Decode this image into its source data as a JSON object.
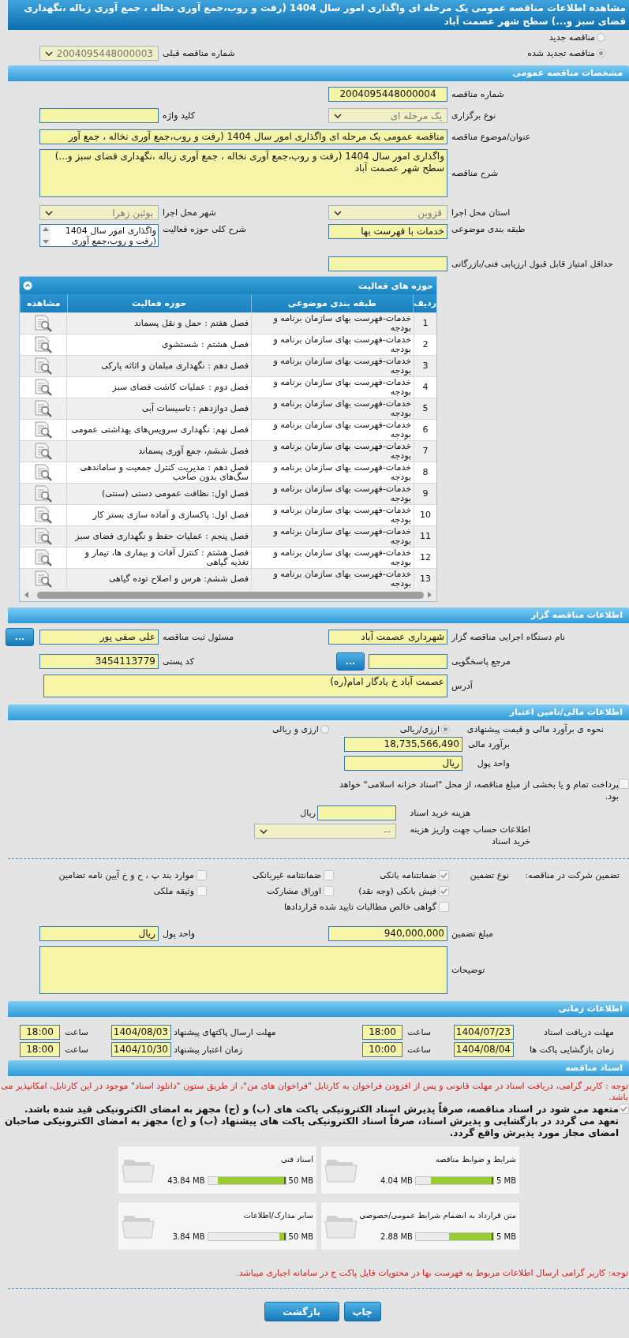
{
  "title": "مشاهده اطلاعات مناقصه عمومی یک مرحله ای واگذاری امور سال 1404 (رفت و روب،جمع آوری نخاله ، جمع آوری زباله ،نگهداری فضای سبز و...) سطح شهر عصمت آباد",
  "tender_kind": [
    {
      "label": "مناقصه جدید",
      "selected": false
    },
    {
      "label": "مناقصه تجدید شده",
      "selected": true
    }
  ],
  "previous_tender": {
    "label": "شماره مناقصه قبلی",
    "value": "2004095448000003"
  },
  "general": {
    "heading": "مشخصات مناقصه عمومی",
    "tender_number": {
      "label": "شماره مناقصه",
      "value": "2004095448000004"
    },
    "holding_type": {
      "label": "نوع برگزاری",
      "value": "یک مرحله ای"
    },
    "keyword": {
      "label": "کلید واژه"
    },
    "subject": {
      "label": "عنوان/موضوع مناقصه",
      "value": "مناقصه عمومی یک مرحله ای واگذاری  امور سال  1404 (رفت و روب،جمع آوری نخاله ، جمع آور"
    },
    "description": {
      "label": "شرح مناقصه",
      "value": "واگذاری  امور سال  1404 (رفت و روب،جمع آوری نخاله ، جمع آوری زباله ،نگهداری فضای سبز و...) سطح  شهر عصمت آباد"
    },
    "province": {
      "label": "استان محل اجرا",
      "value": "قزوین"
    },
    "city": {
      "label": "شهر محل اجرا",
      "value": "بوئین زهرا"
    },
    "category": {
      "label": "طبقه بندی موضوعی",
      "value": "خدمات با فهرست بها"
    },
    "activity_summary": {
      "label": "شرح کلی حوزه فعالیت",
      "lines": [
        "واگذاری  امور سال  1404",
        "(رفت و روب،جمع آوری"
      ]
    },
    "min_score": {
      "label": "حداقل امتیاز قابل قبول ارزیابی فنی/بازرگانی"
    }
  },
  "activities": {
    "title": "حوزه های فعالیت",
    "columns": [
      "ردیف",
      "طبقه بندی موضوعی",
      "حوزه فعالیت",
      "مشاهده"
    ],
    "rows": [
      {
        "n": "1",
        "category": "خدمات-فهرست بهای سازمان برنامه و بودجه",
        "activity": "فصل هفتم : حمل و نقل پسماند"
      },
      {
        "n": "2",
        "category": "خدمات-فهرست بهای سازمان برنامه و بودجه",
        "activity": "فصل هشتم : شستشوی"
      },
      {
        "n": "3",
        "category": "خدمات-فهرست بهای سازمان برنامه و بودجه",
        "activity": "فصل دهم : نگهداری مبلمان و اثاثه پارکی"
      },
      {
        "n": "4",
        "category": "خدمات-فهرست بهای سازمان برنامه و بودجه",
        "activity": "فصل دوم : عملیات کاشت فضای سبز"
      },
      {
        "n": "5",
        "category": "خدمات-فهرست بهای سازمان برنامه و بودجه",
        "activity": "فصل دوازدهم : تاسیسات آبی"
      },
      {
        "n": "6",
        "category": "خدمات-فهرست بهای سازمان برنامه و بودجه",
        "activity": "فصل نهم: نگهداری سرویس‌های بهداشتی عمومی"
      },
      {
        "n": "7",
        "category": "خدمات-فهرست بهای سازمان برنامه و بودجه",
        "activity": "فصل ششم، جمع آوری پسماند"
      },
      {
        "n": "8",
        "category": "خدمات-فهرست بهای سازمان برنامه و بودجه",
        "activity": "فصل دهم : مدیریت کنترل جمعیت و ساماندهی سگ‌های بدون صاحب"
      },
      {
        "n": "9",
        "category": "خدمات-فهرست بهای سازمان برنامه و بودجه",
        "activity": "فصل اول: نظافت عمومی دستی (سنتی)"
      },
      {
        "n": "10",
        "category": "خدمات-فهرست بهای سازمان برنامه و بودجه",
        "activity": "فصل اول:  پاکسازی و آماده سازی بستر کار"
      },
      {
        "n": "11",
        "category": "خدمات-فهرست بهای سازمان برنامه و بودجه",
        "activity": "فصل پنجم : عملیات حفظ و نگهداری فضای سبز"
      },
      {
        "n": "12",
        "category": "خدمات-فهرست بهای سازمان برنامه و بودجه",
        "activity": "فصل هشتم : کنترل آفات و بیماری ها، تیمار و تغذیه گیاهی"
      },
      {
        "n": "13",
        "category": "خدمات-فهرست بهای سازمان برنامه و بودجه",
        "activity": "فصل ششم: هرس و اصلاح توده گیاهی"
      }
    ]
  },
  "tenderer": {
    "heading": "اطلاعات مناقصه گزار",
    "organization": {
      "label": "نام دستگاه اجرایی مناقصه گزار",
      "value": "شهرداری عصمت آباد"
    },
    "registrar": {
      "label": "مسئول ثبت مناقصه",
      "value": "علی صفی پور"
    },
    "more_button": "...",
    "response_ref": {
      "label": "مرجع پاسخگویی"
    },
    "ref_button": "...",
    "postal_code": {
      "label": "کد پستی",
      "value": "3454113779"
    },
    "address": {
      "label": "آدرس",
      "value": "عصمت آباد خ یادگار امام(ره)"
    }
  },
  "finance": {
    "heading": "اطلاعات مالی/تامین اعتبار",
    "method": {
      "label": "نحوه ی برآورد مالی و قیمت پیشنهادی",
      "options": [
        {
          "label": "ارزی/ریالی",
          "selected": true
        },
        {
          "label": "ارزی و ریالی",
          "selected": false
        }
      ]
    },
    "estimate": {
      "label": "برآورد مالی",
      "value": "18,735,566,490"
    },
    "currency": {
      "label": "واحد پول",
      "value": "ریال"
    },
    "treasury": {
      "label": "پرداخت تمام و یا بخشی از مبلغ مناقصه، از محل \"اسناد خزانه اسلامی\" خواهد بود.",
      "checked": false
    },
    "doc_fee": {
      "label": "هزینه خرید اسناد",
      "unit": "ریال"
    },
    "account": {
      "label": "اطلاعات حساب جهت واریز هزینه خرید اسناد",
      "value": "--"
    }
  },
  "guarantee": {
    "label": "تضمین شرکت در مناقصه:",
    "type_label": "نوع تضمین",
    "types": [
      {
        "label": "ضمانتنامه بانکی",
        "checked": true
      },
      {
        "label": "ضمانتنامه غیربانکی",
        "checked": false
      },
      {
        "label": "موارد بند پ ، ح و خ آیین نامه تضامین",
        "checked": false
      },
      {
        "label": "فیش بانکی (وجه نقد)",
        "checked": true
      },
      {
        "label": "اوراق مشارکت",
        "checked": false
      },
      {
        "label": "وثیقه ملکی",
        "checked": false
      },
      {
        "label": "گواهی خالص مطالبات تایید شده قراردادها",
        "checked": false
      }
    ],
    "amount": {
      "label": "مبلغ تضمین",
      "value": "940,000,000"
    },
    "currency": {
      "label": "واحد پول",
      "value": "ریال"
    },
    "notes": {
      "label": "توضیحات"
    }
  },
  "timing": {
    "heading": "اطلاعات زمانی",
    "rows": [
      {
        "label": "مهلت دریافت اسناد",
        "date": "1404/07/23",
        "time_label": "ساعت",
        "time": "18:00"
      },
      {
        "label": "مهلت ارسال پاکتهای پیشنهاد",
        "date": "1404/08/03",
        "time_label": "ساعت",
        "time": "18:00"
      },
      {
        "label": "زمان بازگشایی پاکت ها",
        "date": "1404/08/04",
        "time_label": "ساعت",
        "time": "10:00"
      },
      {
        "label": "زمان اعتبار پیشنهاد",
        "date": "1404/10/30",
        "time_label": "ساعت",
        "time": "18:00"
      }
    ]
  },
  "documents": {
    "heading": "اسناد مناقصه",
    "notice": "توجه : کاربر گرامی، دریافت اسناد در مهلت قانونی و پس از افزودن فراخوان به کارتابل \"فراخوان های من\"، از طریق ستون \"دانلود اسناد\" موجود در این کارتابل، امکانپذیر می باشد.",
    "pledge": {
      "text": "متعهد می شود در اسناد مناقصه، صرفاً پذیرش اسناد الکترونیکی پاکت های (ب) و (ج) مجهز به امضای الکترونیکی قید شده باشد. تعهد می گردد در بازگشایی و پذیرش اسناد، صرفاً اسناد الکترونیکی پاکت های پیشنهاد (ب) و (ج) مجهز به امضای الکترونیکی صاحبان امضای مجاز مورد پذیرش واقع گردد.",
      "checked": true
    },
    "files": [
      {
        "name": "شرایط و ضوابط مناقصه",
        "max": "5 MB",
        "size": "4.04 MB",
        "level": 0.808
      },
      {
        "name": "اسناد فنی",
        "max": "50 MB",
        "size": "43.84 MB",
        "level": 0.877
      },
      {
        "name": "متن قرارداد به انضمام شرایط عمومی/خصوصی",
        "max": "5 MB",
        "size": "2.88 MB",
        "level": 0.576
      },
      {
        "name": "سایر مدارک/اطلاعات",
        "max": "50 MB",
        "size": "3.84 MB",
        "level": 0.077
      }
    ],
    "footnote": "توجه: کاربر گرامی ارسال اطلاعات مربوط به فهرست بها در محتویات فایل پاکت ج در سامانه اجباری میباشد."
  },
  "buttons": [
    {
      "label": "چاپ"
    },
    {
      "label": "بازگشت"
    }
  ]
}
